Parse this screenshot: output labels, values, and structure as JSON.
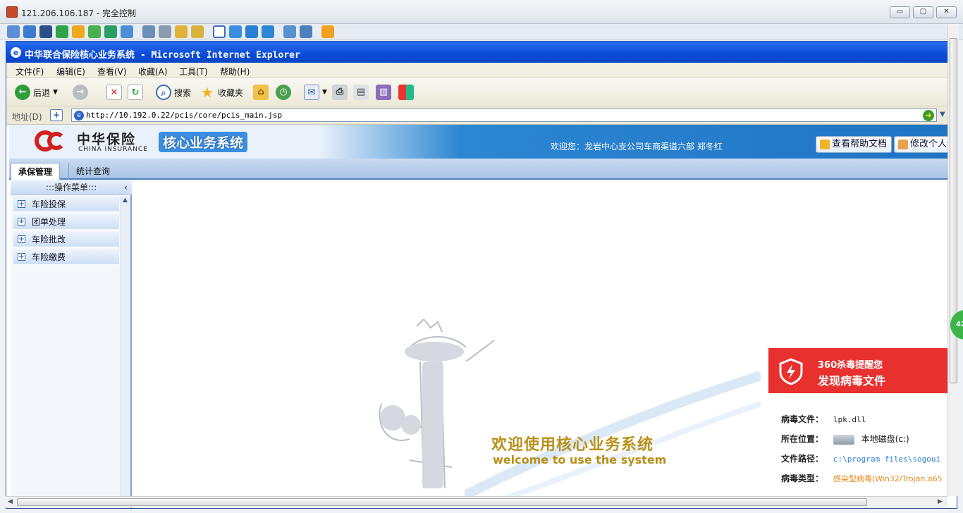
{
  "remote": {
    "title": "121.206.106.187 - 完全控制",
    "buttons": {
      "minimize": "▭",
      "maximize": "▢",
      "close": "✕"
    }
  },
  "ie": {
    "title": "中华联合保险核心业务系统 - Microsoft Internet Explorer",
    "menu": [
      "文件(F)",
      "编辑(E)",
      "查看(V)",
      "收藏(A)",
      "工具(T)",
      "帮助(H)"
    ],
    "toolbar": {
      "back": "后退",
      "search": "搜索",
      "favorites": "收藏夹"
    },
    "address_label": "地址(D)",
    "address": "http://10.192.0.22/pcis/core/pcis_main.jsp"
  },
  "banner": {
    "logo_cn": "中华保险",
    "logo_en": "CHINA INSURANCE",
    "system_name": "核心业务系统",
    "welcome": "欢迎您：龙岩中心支公司车商渠道六部 郑冬红",
    "help_button": "查看帮助文档",
    "modify_button": "修改个人信"
  },
  "tabs": [
    {
      "label": "承保管理",
      "active": true
    },
    {
      "label": "统计查询",
      "active": false
    }
  ],
  "sidebar": {
    "header": ":::操作菜单:::",
    "items": [
      {
        "label": "车险投保"
      },
      {
        "label": "团单处理"
      },
      {
        "label": "车险批改"
      },
      {
        "label": "车险缴费"
      }
    ]
  },
  "main": {
    "welcome_cn": "欢迎使用核心业务系统",
    "welcome_en": "welcome to use the system"
  },
  "antivirus": {
    "line1": "360杀毒提醒您",
    "line2": "发现病毒文件",
    "rows": [
      {
        "label": "病毒文件：",
        "value": "lpk.dll"
      },
      {
        "label": "所在位置：",
        "value": "本地磁盘(c:)"
      },
      {
        "label": "文件路径：",
        "value": "c:\\program files\\sogoui"
      },
      {
        "label": "病毒类型：",
        "value": "感染型病毒(Win32/Trojan.a65"
      }
    ],
    "accent": "#e8302f"
  },
  "edge_badge": "42"
}
